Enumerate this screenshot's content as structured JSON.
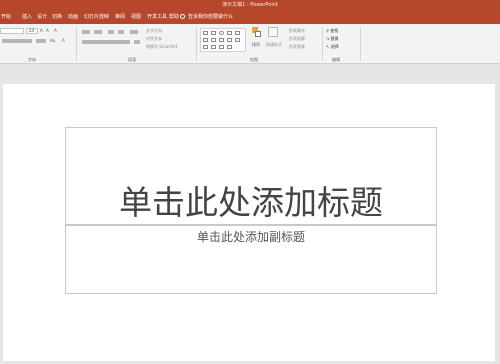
{
  "window": {
    "title": "演示文稿1  -  PowerPoint"
  },
  "tabs": [
    {
      "label": "开始"
    },
    {
      "label": "插入"
    },
    {
      "label": "设计"
    },
    {
      "label": "切换"
    },
    {
      "label": "动画"
    },
    {
      "label": "幻灯片放映"
    },
    {
      "label": "审阅"
    },
    {
      "label": "视图"
    },
    {
      "label": "开发工具"
    },
    {
      "label": "帮助"
    }
  ],
  "tell_me": "告诉我你想要做什么",
  "ribbon": {
    "font_size": "24",
    "paragraph": {
      "text_direction": "文字方向",
      "align_text": "对齐文本",
      "smartart": "转换为 SmartArt"
    },
    "drawing": {
      "arrange": "排列",
      "quick_styles": "快速样式",
      "shape_fill": "形状填充",
      "shape_outline": "形状轮廓",
      "shape_effects": "形状效果"
    },
    "editing": {
      "find": "查找",
      "replace": "替换",
      "select": "选择"
    },
    "groups": {
      "font": "字体",
      "paragraph": "段落",
      "drawing": "绘图",
      "editing": "编辑"
    }
  },
  "slide": {
    "title_placeholder": "单击此处添加标题",
    "subtitle_placeholder": "单击此处添加副标题"
  }
}
